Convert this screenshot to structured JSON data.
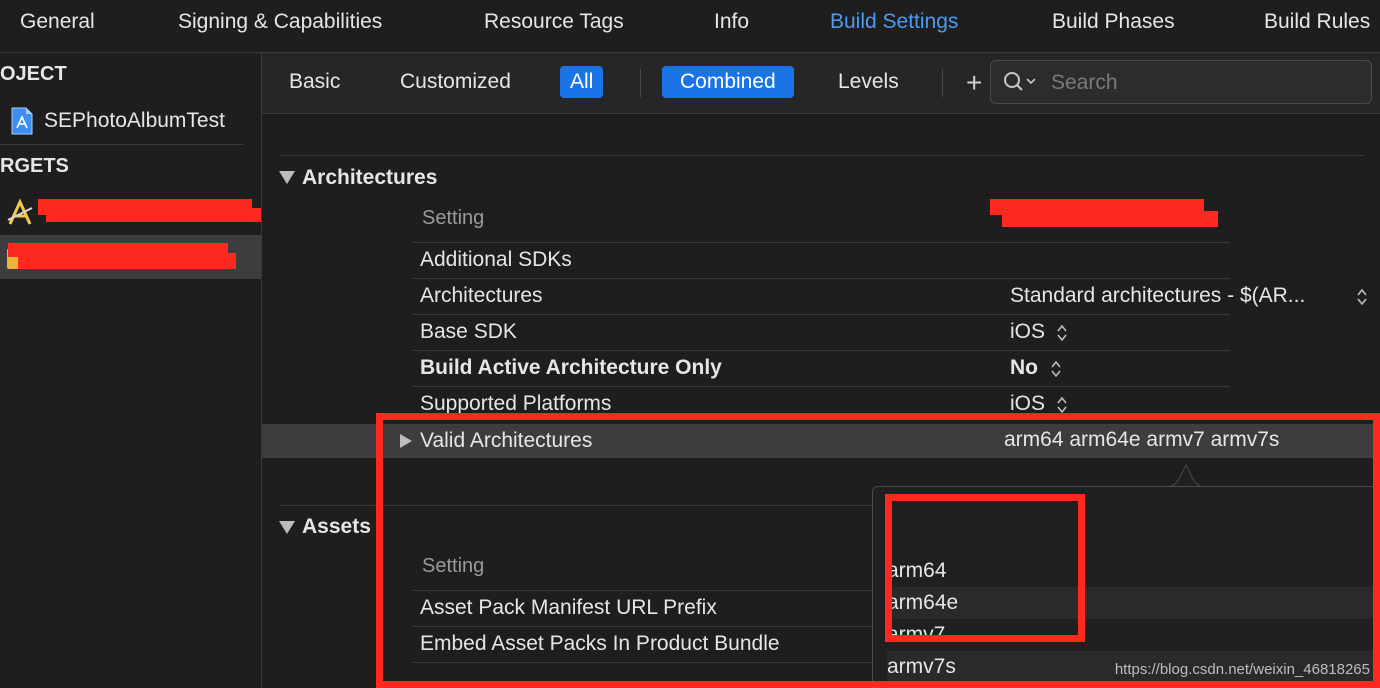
{
  "tabs": [
    "General",
    "Signing & Capabilities",
    "Resource Tags",
    "Info",
    "Build Settings",
    "Build Phases",
    "Build Rules"
  ],
  "active_tab": "Build Settings",
  "sidebar": {
    "project_header": "OJECT",
    "project_item": "SEPhotoAlbumTest",
    "targets_header": "RGETS"
  },
  "filter": {
    "basic": "Basic",
    "customized": "Customized",
    "all": "All",
    "combined": "Combined",
    "levels": "Levels",
    "add": "+",
    "search_placeholder": "Search"
  },
  "architectures": {
    "title": "Architectures",
    "col_setting": "Setting",
    "rows": [
      {
        "name": "Additional SDKs",
        "value": ""
      },
      {
        "name": "Architectures",
        "value": "Standard architectures  -  $(AR..."
      },
      {
        "name": "Base SDK",
        "value": "iOS"
      },
      {
        "name": "Build Active Architecture Only",
        "value": "No"
      },
      {
        "name": "Supported Platforms",
        "value": "iOS"
      },
      {
        "name": "Valid Architectures",
        "value": "arm64 arm64e armv7 armv7s"
      }
    ]
  },
  "assets": {
    "title": "Assets",
    "col_setting": "Setting",
    "rows": [
      {
        "name": "Asset Pack Manifest URL Prefix"
      },
      {
        "name": "Embed Asset Packs In Product Bundle"
      }
    ]
  },
  "popover": {
    "items": [
      "arm64",
      "arm64e",
      "armv7",
      "armv7s"
    ]
  },
  "watermark": "https://blog.csdn.net/weixin_46818265",
  "colors": {
    "accent": "#1a74e8",
    "active_tab": "#4c9bf5",
    "highlight": "#ff2a1f"
  }
}
